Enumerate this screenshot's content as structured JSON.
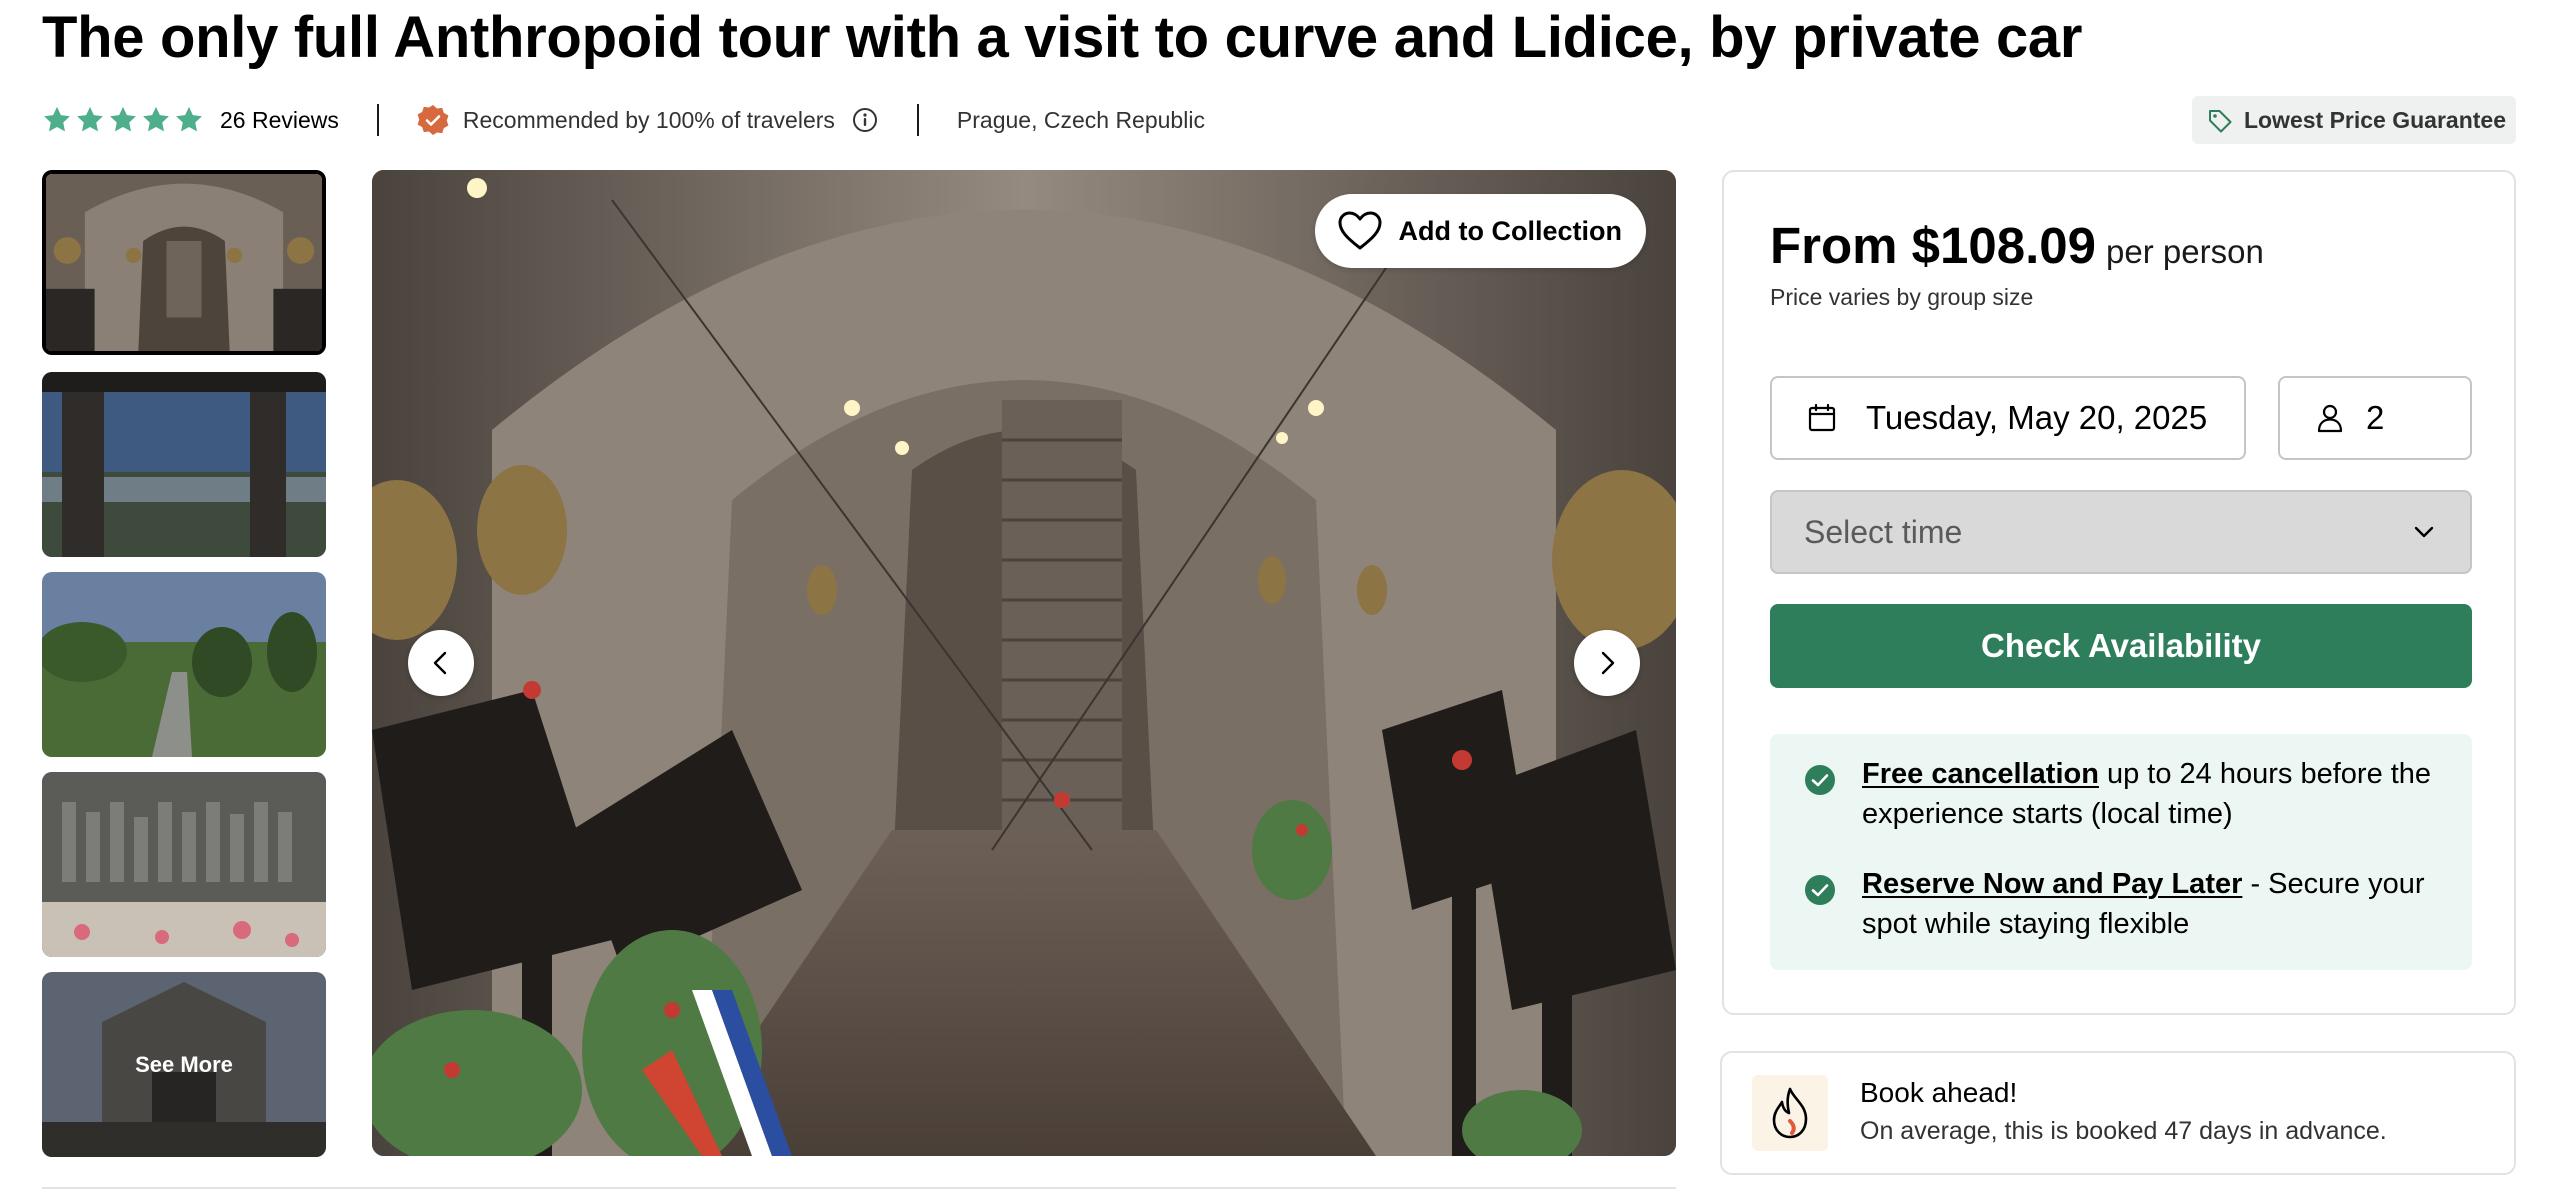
{
  "title": "The only full Anthropoid tour with a visit to curve and Lidice, by private car",
  "rating": {
    "stars": 5,
    "reviews_label": "26 Reviews",
    "star_color": "#4fae8c"
  },
  "recommendation": {
    "text": "Recommended by 100% of travelers",
    "badge_color": "#d6693e",
    "icon": "badge-icon"
  },
  "location": "Prague, Czech Republic",
  "lowest_price": {
    "label": "Lowest Price Guarantee",
    "icon": "tag-icon"
  },
  "gallery": {
    "see_more_label": "See More",
    "add_to_collection_label": "Add to Collection",
    "thumbnails": [
      {
        "name": "crypt"
      },
      {
        "name": "memorial-columns"
      },
      {
        "name": "park-path"
      },
      {
        "name": "children-statues"
      },
      {
        "name": "church-facade"
      }
    ]
  },
  "booking": {
    "price_from": "From $108.09",
    "price_unit": "per person",
    "price_note": "Price varies by group size",
    "date": "Tuesday, May 20, 2025",
    "travelers": "2",
    "time_placeholder": "Select time",
    "check_label": "Check Availability",
    "accent": "#2e7d5b"
  },
  "perks": [
    {
      "link": "Free cancellation",
      "text": " up to 24 hours before the experience starts (local time)"
    },
    {
      "link": "Reserve Now and Pay Later",
      "text": " - Secure your spot while staying flexible"
    }
  ],
  "book_ahead": {
    "title": "Book ahead!",
    "subtitle": "On average, this is booked 47 days in advance."
  }
}
